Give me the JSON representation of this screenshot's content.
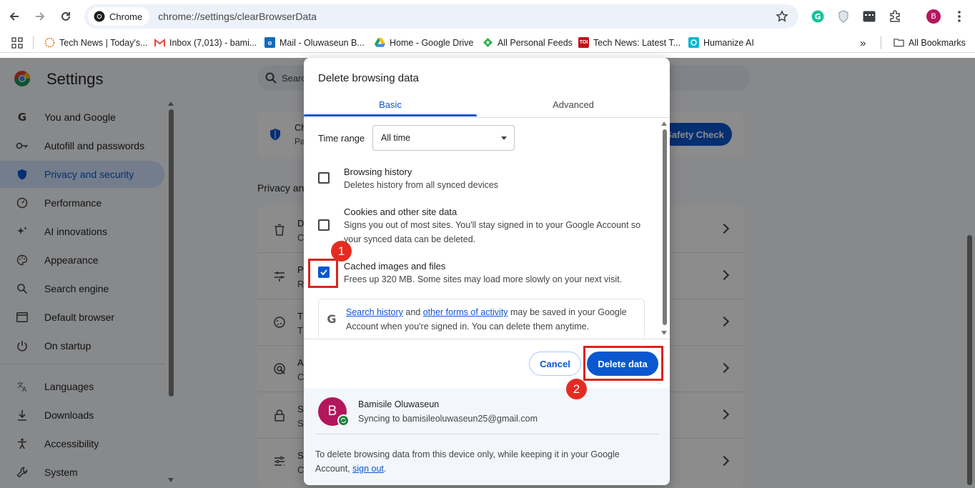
{
  "browser": {
    "chip_label": "Chrome",
    "url": "chrome://settings/clearBrowserData",
    "avatar_letter": "B"
  },
  "bookmarks": {
    "items": [
      {
        "label": "Tech News | Today's...",
        "icon": "sun-icon",
        "color": "#e8710a"
      },
      {
        "label": "Inbox (7,013) - bami...",
        "icon": "gmail-icon",
        "color": "#ea4335"
      },
      {
        "label": "Mail - Oluwaseun B...",
        "icon": "outlook-icon",
        "color": "#0f6cbd"
      },
      {
        "label": "Home - Google Drive",
        "icon": "drive-icon",
        "color": "#1fa463"
      },
      {
        "label": "All Personal Feeds",
        "icon": "feedly-icon",
        "color": "#2bb24c"
      },
      {
        "label": "Tech News: Latest T...",
        "icon": "toi-icon",
        "color": "#c0131a"
      },
      {
        "label": "Humanize AI",
        "icon": "humanize-icon",
        "color": "#0bb8d6"
      }
    ],
    "overflow": "»",
    "all_bookmarks": "All Bookmarks"
  },
  "settings": {
    "title": "Settings",
    "search_placeholder": "Search",
    "sidebar": [
      {
        "label": "You and Google",
        "icon": "google-g-icon"
      },
      {
        "label": "Autofill and passwords",
        "icon": "key-icon"
      },
      {
        "label": "Privacy and security",
        "icon": "shield-icon",
        "active": true
      },
      {
        "label": "Performance",
        "icon": "speedometer-icon"
      },
      {
        "label": "AI innovations",
        "icon": "sparkle-icon"
      },
      {
        "label": "Appearance",
        "icon": "palette-icon"
      },
      {
        "label": "Search engine",
        "icon": "magnifier-icon"
      },
      {
        "label": "Default browser",
        "icon": "browser-window-icon"
      },
      {
        "label": "On startup",
        "icon": "power-icon"
      },
      {
        "label": "Languages",
        "icon": "translate-icon"
      },
      {
        "label": "Downloads",
        "icon": "download-icon"
      },
      {
        "label": "Accessibility",
        "icon": "accessibility-icon"
      },
      {
        "label": "System",
        "icon": "wrench-icon"
      }
    ],
    "safety_card_fragment": "Ch",
    "safety_card_fragment2": "Pa",
    "safety_check_button": "Safety Check",
    "privacy_section_fragment": "Privacy an",
    "rows": [
      {
        "icon": "trash-icon",
        "line1": "D",
        "line2": "C"
      },
      {
        "icon": "sliders-icon",
        "line1": "P",
        "line2": "R"
      },
      {
        "icon": "cookie-icon",
        "line1": "T",
        "line2": "T"
      },
      {
        "icon": "ad-target-icon",
        "line1": "A",
        "line2": "C"
      },
      {
        "icon": "lock-icon",
        "line1": "S",
        "line2": "S"
      },
      {
        "icon": "tune-icon",
        "line1": "S",
        "line2": "C"
      }
    ]
  },
  "dialog": {
    "title": "Delete browsing data",
    "tabs": [
      "Basic",
      "Advanced"
    ],
    "time_range_label": "Time range",
    "time_range_value": "All time",
    "options": [
      {
        "title": "Browsing history",
        "desc": "Deletes history from all synced devices",
        "checked": false
      },
      {
        "title": "Cookies and other site data",
        "desc": "Signs you out of most sites. You'll stay signed in to your Google Account so your synced data can be deleted.",
        "checked": false
      },
      {
        "title": "Cached images and files",
        "desc": "Frees up 320 MB. Some sites may load more slowly on your next visit.",
        "checked": true
      }
    ],
    "info": {
      "link1": "Search history",
      "mid1": " and ",
      "link2": "other forms of activity",
      "rest": " may be saved in your Google Account when you're signed in. You can delete them anytime."
    },
    "cancel": "Cancel",
    "delete": "Delete data",
    "account": {
      "avatar_letter": "B",
      "name": "Bamisile Oluwaseun",
      "sync": "Syncing to bamisileoluwaseun25@gmail.com",
      "note_prefix": "To delete browsing data from this device only, while keeping it in your Google Account, ",
      "sign_out": "sign out",
      "note_suffix": "."
    }
  },
  "annotations": {
    "badge1": "1",
    "badge2": "2",
    "highlight_color": "#d9251c"
  },
  "colors": {
    "accent": "#0b57d0",
    "active_nav_bg": "#d3e3fd",
    "avatar": "#b3165c"
  }
}
